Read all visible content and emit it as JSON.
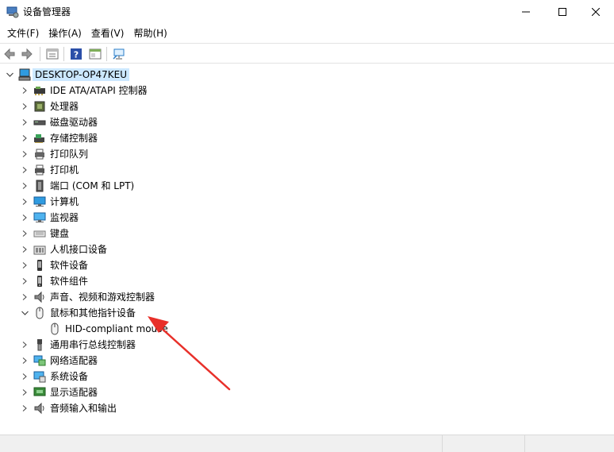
{
  "window": {
    "title": "设备管理器",
    "icon": "device-manager-icon"
  },
  "menu": {
    "items": [
      {
        "label": "文件(F)"
      },
      {
        "label": "操作(A)"
      },
      {
        "label": "查看(V)"
      },
      {
        "label": "帮助(H)"
      }
    ]
  },
  "toolbar": {
    "buttons": [
      "back-arrow-icon",
      "forward-arrow-icon",
      "properties-icon",
      "help-icon",
      "show-hide-icon",
      "scan-hardware-icon"
    ]
  },
  "tree": {
    "root": {
      "label": "DESKTOP-OP47KEU",
      "expanded": true
    },
    "categories": [
      {
        "label": "IDE ATA/ATAPI 控制器",
        "icon": "ide-controller-icon"
      },
      {
        "label": "处理器",
        "icon": "processor-icon"
      },
      {
        "label": "磁盘驱动器",
        "icon": "disk-drive-icon"
      },
      {
        "label": "存储控制器",
        "icon": "storage-controller-icon"
      },
      {
        "label": "打印队列",
        "icon": "print-queue-icon"
      },
      {
        "label": "打印机",
        "icon": "printer-icon"
      },
      {
        "label": "端口 (COM 和 LPT)",
        "icon": "port-icon"
      },
      {
        "label": "计算机",
        "icon": "computer-icon"
      },
      {
        "label": "监视器",
        "icon": "monitor-icon"
      },
      {
        "label": "键盘",
        "icon": "keyboard-icon"
      },
      {
        "label": "人机接口设备",
        "icon": "hid-icon"
      },
      {
        "label": "软件设备",
        "icon": "software-device-icon"
      },
      {
        "label": "软件组件",
        "icon": "software-component-icon"
      },
      {
        "label": "声音、视频和游戏控制器",
        "icon": "sound-icon"
      },
      {
        "label": "鼠标和其他指针设备",
        "icon": "mouse-icon",
        "expanded": true,
        "children": [
          {
            "label": "HID-compliant mouse",
            "icon": "mouse-icon"
          }
        ]
      },
      {
        "label": "通用串行总线控制器",
        "icon": "usb-icon"
      },
      {
        "label": "网络适配器",
        "icon": "network-adapter-icon"
      },
      {
        "label": "系统设备",
        "icon": "system-device-icon"
      },
      {
        "label": "显示适配器",
        "icon": "display-adapter-icon"
      },
      {
        "label": "音频输入和输出",
        "icon": "audio-io-icon"
      }
    ]
  },
  "colors": {
    "selection": "#cce8ff",
    "arrow": "#e8302a"
  }
}
